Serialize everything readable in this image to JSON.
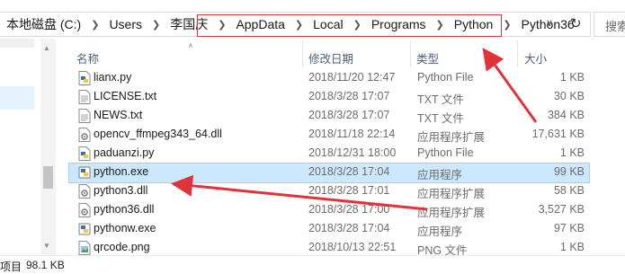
{
  "address": {
    "crumbs": [
      "本地磁盘 (C:)",
      "Users",
      "李国庆",
      "AppData",
      "Local",
      "Programs",
      "Python",
      "Python36"
    ],
    "search_placeholder": "搜索"
  },
  "columns": {
    "name": "名称",
    "date": "修改日期",
    "type": "类型",
    "size": "大小"
  },
  "files": [
    {
      "name": "lianx.py",
      "date": "2018/11/20 12:47",
      "type": "Python File",
      "size": "1 KB",
      "icon": "python-file-icon"
    },
    {
      "name": "LICENSE.txt",
      "date": "2018/3/28 17:07",
      "type": "TXT 文件",
      "size": "30 KB",
      "icon": "text-file-icon"
    },
    {
      "name": "NEWS.txt",
      "date": "2018/3/28 17:07",
      "type": "TXT 文件",
      "size": "384 KB",
      "icon": "text-file-icon"
    },
    {
      "name": "opencv_ffmpeg343_64.dll",
      "date": "2018/11/18 22:14",
      "type": "应用程序扩展",
      "size": "17,631 KB",
      "icon": "dll-file-icon"
    },
    {
      "name": "paduanzi.py",
      "date": "2018/12/31 18:00",
      "type": "Python File",
      "size": "1 KB",
      "icon": "python-file-icon"
    },
    {
      "name": "python.exe",
      "date": "2018/3/28 17:04",
      "type": "应用程序",
      "size": "99 KB",
      "icon": "python-exe-icon",
      "selected": true
    },
    {
      "name": "python3.dll",
      "date": "2018/3/28 17:01",
      "type": "应用程序扩展",
      "size": "58 KB",
      "icon": "dll-file-icon"
    },
    {
      "name": "python36.dll",
      "date": "2018/3/28 17:00",
      "type": "应用程序扩展",
      "size": "3,527 KB",
      "icon": "dll-file-icon"
    },
    {
      "name": "pythonw.exe",
      "date": "2018/3/28 17:04",
      "type": "应用程序",
      "size": "97 KB",
      "icon": "python-exe-icon"
    },
    {
      "name": "qrcode.png",
      "date": "2018/10/13 22:51",
      "type": "PNG 文件",
      "size": "1 KB",
      "icon": "image-file-icon"
    }
  ],
  "status": {
    "items": "项目",
    "selection_size": "98.1 KB"
  },
  "colors": {
    "selected_row": "#cce8ff",
    "annotation": "#e0333a",
    "header_text": "#4c607a"
  }
}
